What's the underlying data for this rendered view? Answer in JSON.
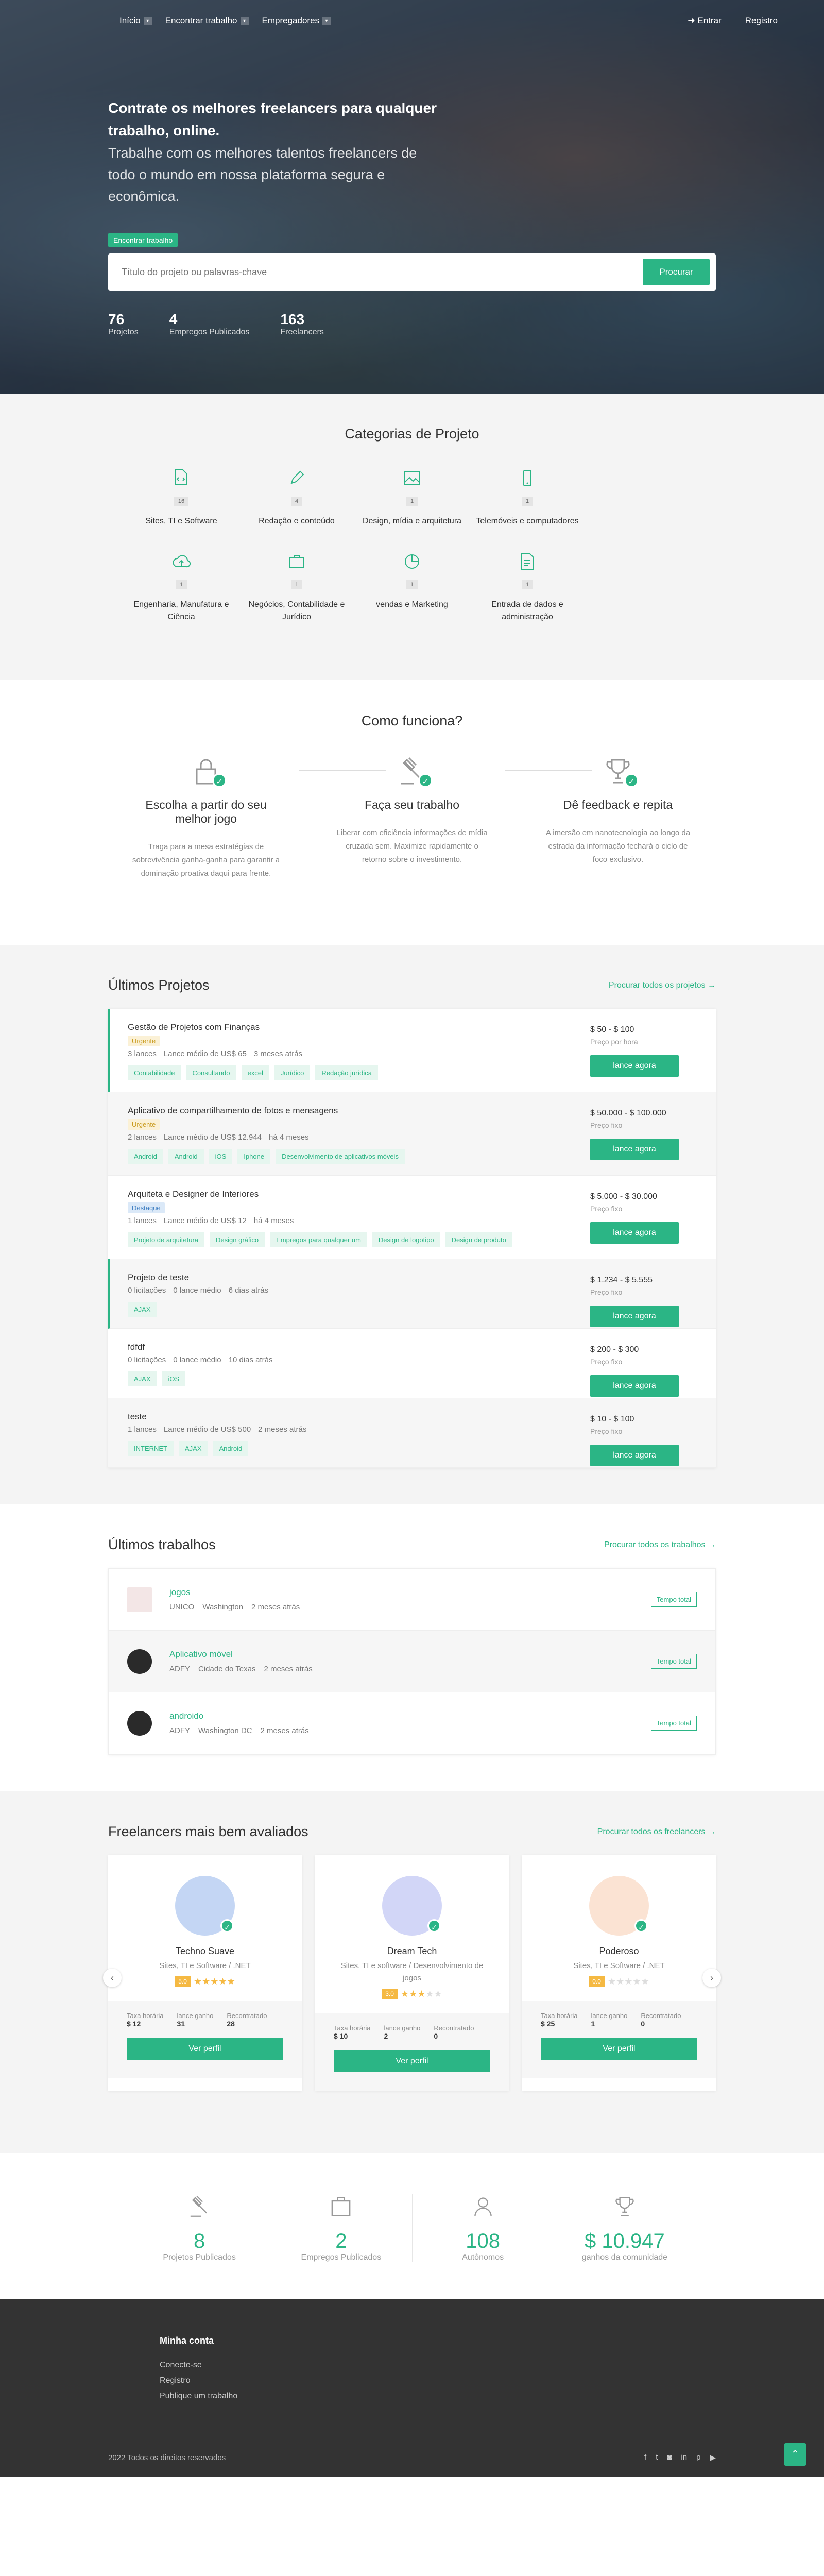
{
  "nav": {
    "items": [
      "Início",
      "Encontrar trabalho",
      "Empregadores"
    ],
    "login": "Entrar",
    "register": "Registro"
  },
  "hero": {
    "title": "Contrate os melhores freelancers para qualquer trabalho, online.",
    "subtitle": "Trabalhe com os melhores talentos freelancers de todo o mundo em nossa plataforma segura e econômica.",
    "pill": "Encontrar trabalho",
    "search_placeholder": "Título do projeto ou palavras-chave",
    "search_button": "Procurar",
    "stats": [
      {
        "n": "76",
        "l": "Projetos"
      },
      {
        "n": "4",
        "l": "Empregos Publicados"
      },
      {
        "n": "163",
        "l": "Freelancers"
      }
    ]
  },
  "categories": {
    "title": "Categorias de Projeto",
    "items": [
      {
        "count": "16",
        "name": "Sites, TI e Software",
        "icon": "file-code-icon"
      },
      {
        "count": "4",
        "name": "Redação e conteúdo",
        "icon": "pencil-icon"
      },
      {
        "count": "1",
        "name": "Design, mídia e arquitetura",
        "icon": "image-icon"
      },
      {
        "count": "1",
        "name": "Telemóveis e computadores",
        "icon": "mobile-icon"
      },
      {
        "count": "",
        "name": "",
        "icon": ""
      },
      {
        "count": "1",
        "name": "Engenharia, Manufatura e Ciência",
        "icon": "cloud-upload-icon"
      },
      {
        "count": "1",
        "name": "Negócios, Contabilidade e Jurídico",
        "icon": "briefcase-icon"
      },
      {
        "count": "1",
        "name": "vendas e Marketing",
        "icon": "pie-chart-icon"
      },
      {
        "count": "1",
        "name": "Entrada de dados e administração",
        "icon": "document-icon"
      }
    ]
  },
  "how": {
    "title": "Como funciona?",
    "steps": [
      {
        "t": "Escolha a partir do seu melhor jogo",
        "d": "Traga para a mesa estratégias de sobrevivência ganha-ganha para garantir a dominação proativa daqui para frente.",
        "icon": "lock-icon"
      },
      {
        "t": "Faça seu trabalho",
        "d": "Liberar com eficiência informações de mídia cruzada sem. Maximize rapidamente o retorno sobre o investimento.",
        "icon": "gavel-icon"
      },
      {
        "t": "Dê feedback e repita",
        "d": "A imersão em nanotecnologia ao longo da estrada da informação fechará o ciclo de foco exclusivo.",
        "icon": "trophy-icon"
      }
    ]
  },
  "projects": {
    "title": "Últimos Projetos",
    "link": "Procurar todos os projetos →",
    "button": "lance agora",
    "items": [
      {
        "t": "Gestão de Projetos com Finanças",
        "badge": "Urgente",
        "bt": "urg",
        "meta": [
          "3 lances",
          "Lance médio de US$ 65",
          "3 meses atrás"
        ],
        "tags": [
          "Contabilidade",
          "Consultando",
          "excel",
          "Jurídico",
          "Redação jurídica"
        ],
        "price": "$ 50 - $ 100",
        "ptype": "Preço por hora",
        "hl": true
      },
      {
        "t": "Aplicativo de compartilhamento de fotos e mensagens",
        "badge": "Urgente",
        "bt": "urg",
        "meta": [
          "2 lances",
          "Lance médio de US$ 12.944",
          "há 4 meses"
        ],
        "tags": [
          "Android",
          "Android",
          "iOS",
          "Iphone",
          "Desenvolvimento de aplicativos móveis"
        ],
        "price": "$ 50.000 - $ 100.000",
        "ptype": "Preço fixo",
        "hl": false
      },
      {
        "t": "Arquiteta e Designer de Interiores",
        "badge": "Destaque",
        "bt": "des",
        "meta": [
          "1 lances",
          "Lance médio de US$ 12",
          "há 4 meses"
        ],
        "tags": [
          "Projeto de arquitetura",
          "Design gráfico",
          "Empregos para qualquer um",
          "Design de logotipo",
          "Design de produto"
        ],
        "price": "$ 5.000 - $ 30.000",
        "ptype": "Preço fixo",
        "hl": false
      },
      {
        "t": "Projeto de teste",
        "badge": "",
        "bt": "",
        "meta": [
          "0 licitações",
          "0 lance médio",
          "6 dias atrás"
        ],
        "tags": [
          "AJAX"
        ],
        "price": "$ 1.234 - $ 5.555",
        "ptype": "Preço fixo",
        "hl": true
      },
      {
        "t": "fdfdf",
        "badge": "",
        "bt": "",
        "meta": [
          "0 licitações",
          "0 lance médio",
          "10 dias atrás"
        ],
        "tags": [
          "AJAX",
          "iOS"
        ],
        "price": "$ 200 - $ 300",
        "ptype": "Preço fixo",
        "hl": false
      },
      {
        "t": "teste",
        "badge": "",
        "bt": "",
        "meta": [
          "1 lances",
          "Lance médio de US$ 500",
          "2 meses atrás"
        ],
        "tags": [
          "INTERNET",
          "AJAX",
          "Android"
        ],
        "price": "$ 10 - $ 100",
        "ptype": "Preço fixo",
        "hl": false
      }
    ]
  },
  "jobs": {
    "title": "Últimos trabalhos",
    "link": "Procurar todos os trabalhos →",
    "items": [
      {
        "t": "jogos",
        "co": "UNICO",
        "loc": "Washington",
        "time": "2 meses atrás",
        "type": "Tempo total"
      },
      {
        "t": "Aplicativo móvel",
        "co": "ADFY",
        "loc": "Cidade do Texas",
        "time": "2 meses atrás",
        "type": "Tempo total"
      },
      {
        "t": "androido",
        "co": "ADFY",
        "loc": "Washington DC",
        "time": "2 meses atrás",
        "type": "Tempo total"
      }
    ]
  },
  "freelancers": {
    "title": "Freelancers mais bem avaliados",
    "link": "Procurar todos os freelancers →",
    "button": "Ver perfil",
    "labels": [
      "Taxa horária",
      "lance ganho",
      "Recontratado"
    ],
    "items": [
      {
        "name": "Techno Suave",
        "role": "Sites, TI e Software / .NET",
        "score": "5.0",
        "stars": 5,
        "rate": "$ 12",
        "won": "31",
        "rehired": "28",
        "color": "#c4d6f4"
      },
      {
        "name": "Dream Tech",
        "role": "Sites, TI e software / Desenvolvimento de jogos",
        "score": "3.0",
        "stars": 3,
        "rate": "$ 10",
        "won": "2",
        "rehired": "0",
        "color": "#d2d6f7"
      },
      {
        "name": "Poderoso",
        "role": "Sites, TI e Software / .NET",
        "score": "0.0",
        "stars": 0,
        "rate": "$ 25",
        "won": "1",
        "rehired": "0",
        "color": "#fbe3d3"
      }
    ]
  },
  "counters": [
    {
      "n": "8",
      "l": "Projetos Publicados",
      "icon": "gavel-icon"
    },
    {
      "n": "2",
      "l": "Empregos Publicados",
      "icon": "briefcase-icon"
    },
    {
      "n": "108",
      "l": "Autônomos",
      "icon": "user-icon"
    },
    {
      "n": "$ 10.947",
      "l": "ganhos da comunidade",
      "icon": "trophy-icon"
    }
  ],
  "footer": {
    "heading": "Minha conta",
    "links": [
      "Conecte-se",
      "Registro",
      "Publique um trabalho"
    ],
    "copyright": "2022 Todos os direitos reservados"
  },
  "colors": {
    "accent": "#2bb585",
    "footer": "#333333"
  }
}
